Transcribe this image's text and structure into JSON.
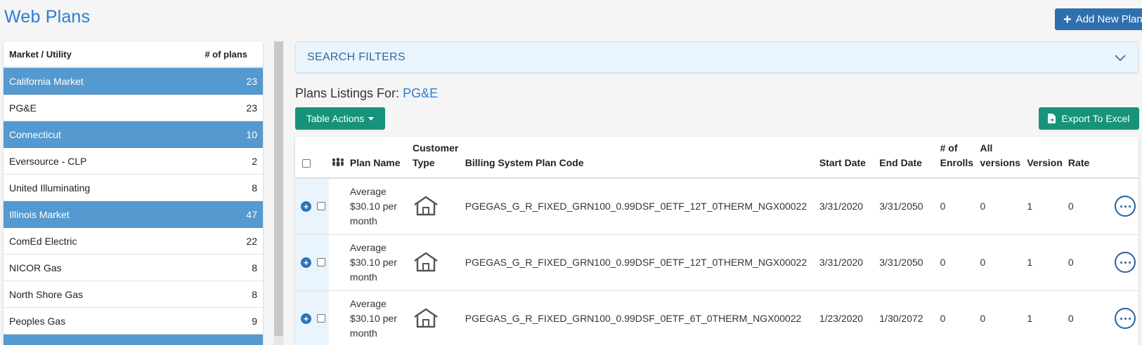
{
  "header": {
    "title": "Web Plans",
    "add_button": "Add New Plan"
  },
  "sidebar": {
    "col_market": "Market / Utility",
    "col_count": "# of plans",
    "rows": [
      {
        "label": "California Market",
        "count": "23",
        "kind": "market"
      },
      {
        "label": "PG&E",
        "count": "23",
        "kind": "utility"
      },
      {
        "label": "Connecticut",
        "count": "10",
        "kind": "market"
      },
      {
        "label": "Eversource - CLP",
        "count": "2",
        "kind": "utility"
      },
      {
        "label": "United Illuminating",
        "count": "8",
        "kind": "utility"
      },
      {
        "label": "Illinois Market",
        "count": "47",
        "kind": "market"
      },
      {
        "label": "ComEd Electric",
        "count": "22",
        "kind": "utility"
      },
      {
        "label": "NICOR Gas",
        "count": "8",
        "kind": "utility"
      },
      {
        "label": "North Shore Gas",
        "count": "8",
        "kind": "utility"
      },
      {
        "label": "Peoples Gas",
        "count": "9",
        "kind": "utility"
      },
      {
        "label": "",
        "count": "",
        "kind": "market"
      }
    ]
  },
  "search": {
    "label": "SEARCH FILTERS"
  },
  "listing": {
    "prefix": "Plans Listings For:",
    "utility": "PG&E",
    "table_actions": "Table Actions",
    "export": "Export To Excel"
  },
  "table": {
    "headers": {
      "plan_name": "Plan Name",
      "customer_type_1": "Customer",
      "customer_type_2": "Type",
      "code": "Billing System Plan Code",
      "start": "Start Date",
      "end": "End Date",
      "enrolls_1": "# of",
      "enrolls_2": "Enrolls",
      "all_versions_1": "All",
      "all_versions_2": "versions",
      "version": "Version",
      "rate": "Rate"
    },
    "rows": [
      {
        "plan_l1": "Average",
        "plan_l2": "$30.10 per",
        "plan_l3": "month",
        "customer_icon": "house-icon",
        "code": "PGEGAS_G_R_FIXED_GRN100_0.99DSF_0ETF_12T_0THERM_NGX00022",
        "start": "3/31/2020",
        "end": "3/31/2050",
        "enrolls": "0",
        "all_versions": "0",
        "version": "1",
        "rate": "0"
      },
      {
        "plan_l1": "Average",
        "plan_l2": "$30.10 per",
        "plan_l3": "month",
        "customer_icon": "house-icon",
        "code": "PGEGAS_G_R_FIXED_GRN100_0.99DSF_0ETF_12T_0THERM_NGX00022",
        "start": "3/31/2020",
        "end": "3/31/2050",
        "enrolls": "0",
        "all_versions": "0",
        "version": "1",
        "rate": "0"
      },
      {
        "plan_l1": "Average",
        "plan_l2": "$30.10 per",
        "plan_l3": "month",
        "customer_icon": "house-icon",
        "code": "PGEGAS_G_R_FIXED_GRN100_0.99DSF_0ETF_6T_0THERM_NGX00022",
        "start": "1/23/2020",
        "end": "1/30/2072",
        "enrolls": "0",
        "all_versions": "0",
        "version": "1",
        "rate": "0"
      }
    ]
  }
}
